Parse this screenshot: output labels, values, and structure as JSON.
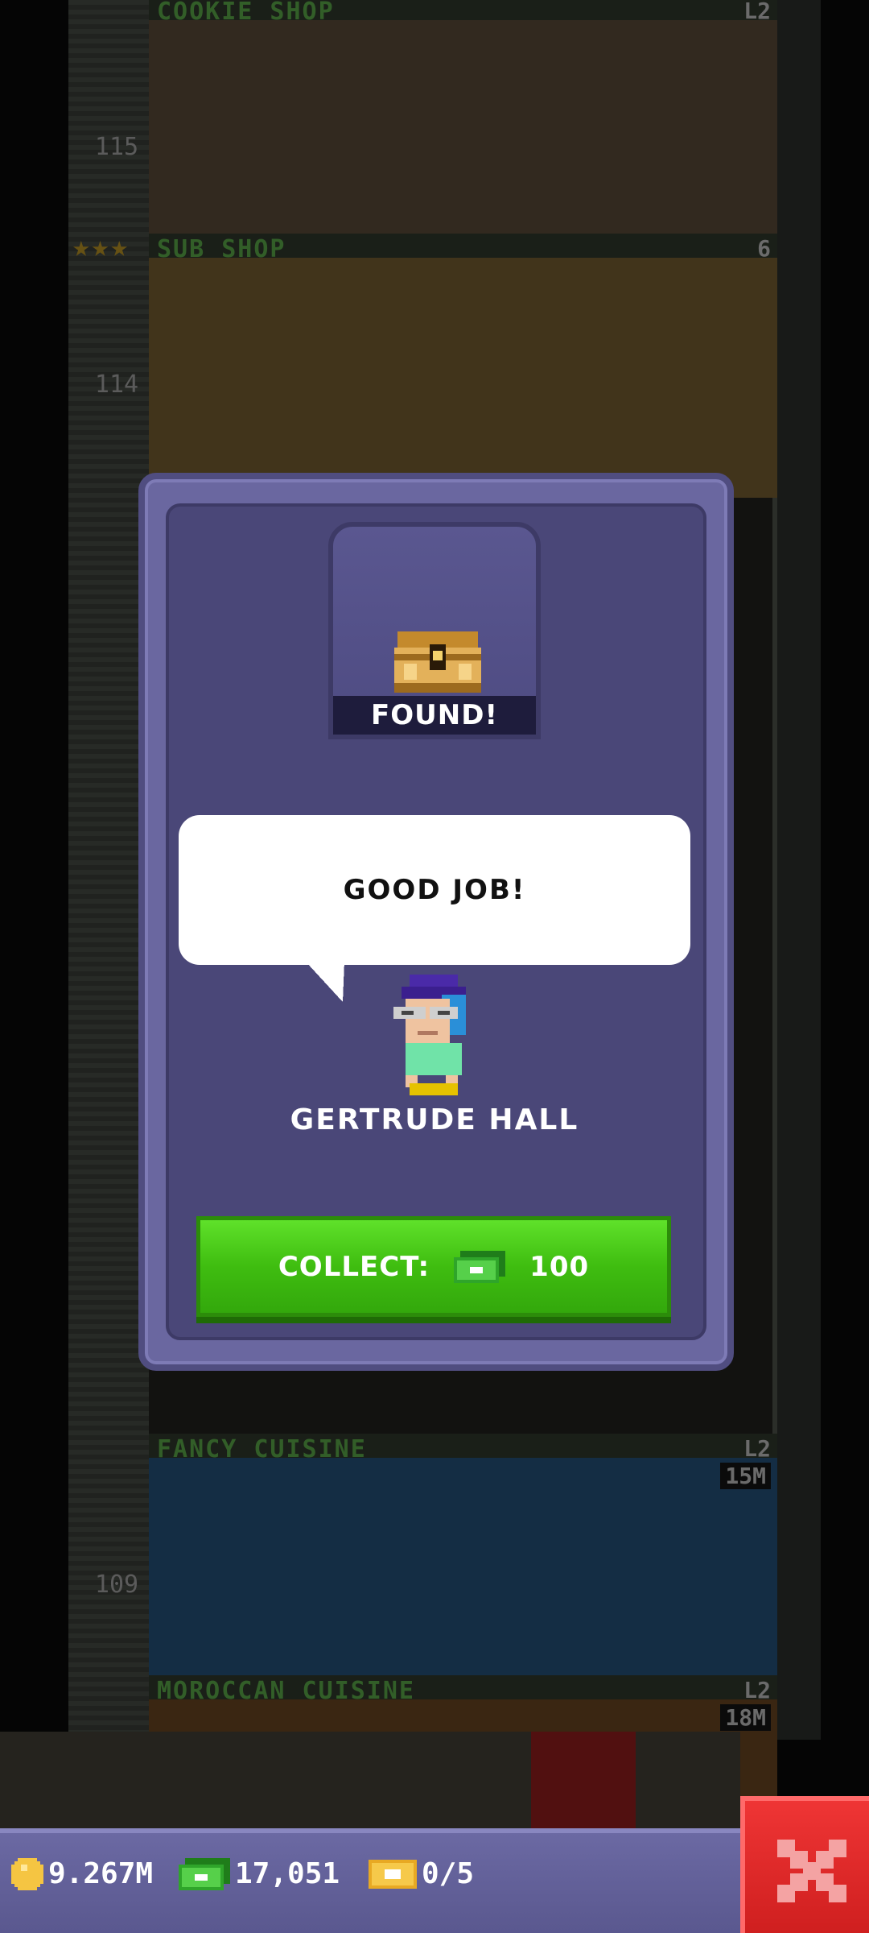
{
  "background": {
    "floors": [
      {
        "name": "COOKIE SHOP",
        "floor_number": "",
        "level": "L2",
        "cost": ""
      },
      {
        "name": "SUB SHOP",
        "floor_number": "114",
        "level": "6",
        "cost": ""
      },
      {
        "name": "FANCY CUISINE",
        "floor_number": "109",
        "level": "L2",
        "cost": "15M"
      },
      {
        "name": "MOROCCAN CUISINE",
        "floor_number": "",
        "level": "L2",
        "cost": "18M"
      }
    ],
    "extra_floor_number": "115"
  },
  "modal": {
    "found_label": "FOUND!",
    "speech": "GOOD JOB!",
    "character_name": "GERTRUDE HALL",
    "collect_label": "COLLECT:",
    "collect_amount": "100"
  },
  "status": {
    "coins": "9.267M",
    "bux": "17,051",
    "tickets": "0/5"
  },
  "colors": {
    "accent_green": "#3fbd10",
    "modal_purple": "#4a4778",
    "close_red": "#cf1f1f",
    "coin_gold": "#f5c542",
    "bux_green": "#2fa52a"
  }
}
